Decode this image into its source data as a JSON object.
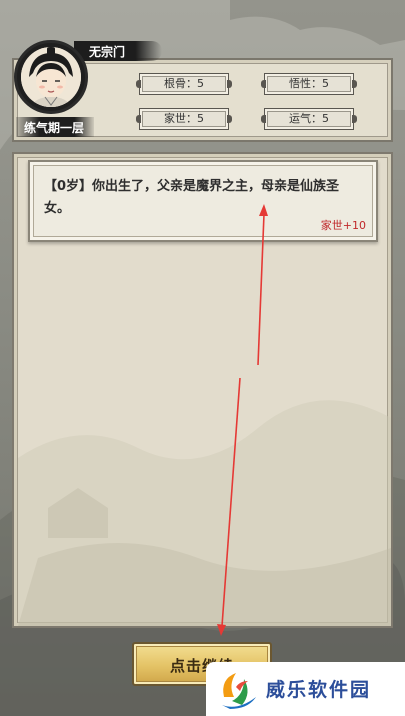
{
  "profile": {
    "sect": "无宗门",
    "realm": "练气期一层"
  },
  "stats": [
    {
      "label": "根骨：5"
    },
    {
      "label": "悟性：5"
    },
    {
      "label": "家世：5"
    },
    {
      "label": "运气：5"
    }
  ],
  "log": {
    "entry_text": "【0岁】你出生了，父亲是魔界之主，母亲是仙族圣女。",
    "gain": "家世+10"
  },
  "continue_button": {
    "label": "点击继续"
  },
  "watermark": {
    "text": "威乐软件园"
  },
  "colors": {
    "gain_red": "#c0282a",
    "button_gold": "#e4c366",
    "arrow_red": "#e53935"
  }
}
